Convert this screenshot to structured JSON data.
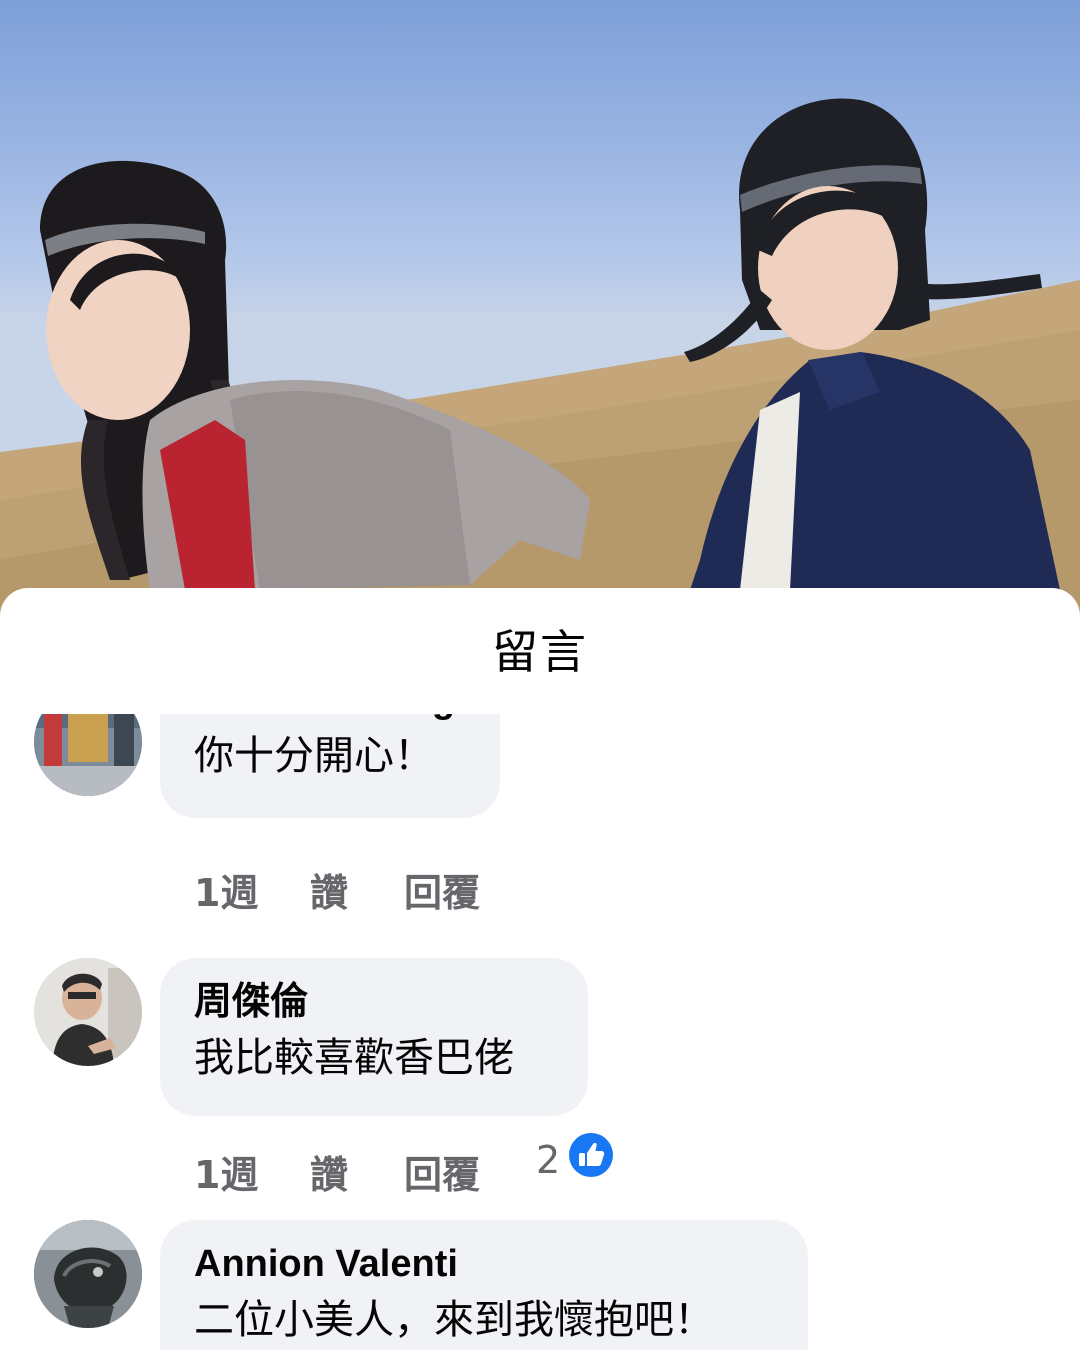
{
  "sheet": {
    "title": "留言"
  },
  "comments": [
    {
      "author": "Silk Lan Wong",
      "text": "你十分開心！",
      "time": "1週",
      "like_label": "讚",
      "reply_label": "回覆",
      "reaction_count": ""
    },
    {
      "author": "周傑倫",
      "text": "我比較喜歡香巴佬",
      "time": "1週",
      "like_label": "讚",
      "reply_label": "回覆",
      "reaction_count": "2"
    },
    {
      "author": "Annion Valenti",
      "text": "二位小美人，來到我懷抱吧！",
      "time": "",
      "like_label": "",
      "reply_label": "",
      "reaction_count": ""
    }
  ],
  "colors": {
    "bubble_bg": "#f0f2f5",
    "action_text": "#65676b",
    "like_blue": "#1877f2"
  },
  "icons": {
    "like": "thumbs-up-icon"
  }
}
